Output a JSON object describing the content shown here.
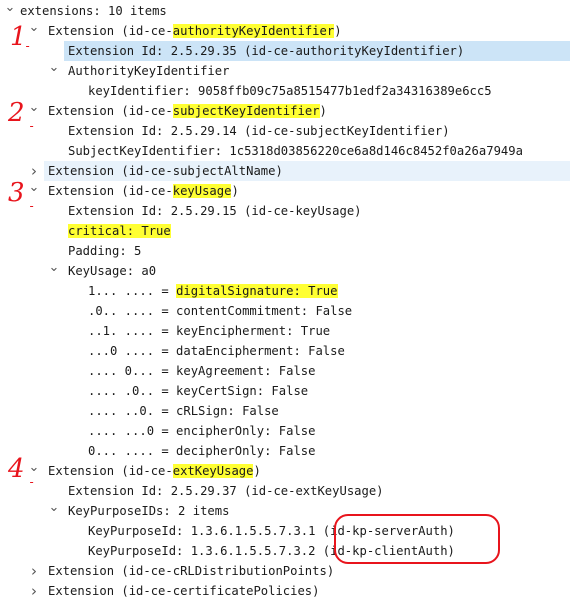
{
  "tree": {
    "rows": [
      {
        "text": "extensions: 10 items",
        "toggle": "v"
      },
      {
        "text": "Extension (id-ce-",
        "mark": "authorityKeyIdentifier",
        "after": ")",
        "toggle": "v"
      },
      {
        "text": "Extension Id: 2.5.29.35 (id-ce-authorityKeyIdentifier)",
        "toggle": ""
      },
      {
        "text": "AuthorityKeyIdentifier",
        "toggle": "v"
      },
      {
        "text": "keyIdentifier: 9058ffb09c75a8515477b1edf2a34316389e6cc5",
        "toggle": ""
      },
      {
        "text": "Extension (id-ce-",
        "mark": "subjectKeyIdentifier",
        "after": ")",
        "toggle": "v"
      },
      {
        "text": "Extension Id: 2.5.29.14 (id-ce-subjectKeyIdentifier)",
        "toggle": ""
      },
      {
        "text": "SubjectKeyIdentifier: 1c5318d03856220ce6a8d146c8452f0a26a7949a",
        "toggle": ""
      },
      {
        "text": "Extension (id-ce-subjectAltName)",
        "toggle": ">"
      },
      {
        "text": "Extension (id-ce-",
        "mark": "keyUsage",
        "after": ")",
        "toggle": "v"
      },
      {
        "text": "Extension Id: 2.5.29.15 (id-ce-keyUsage)",
        "toggle": ""
      },
      {
        "text": "",
        "mark": "critical: True",
        "after": "",
        "toggle": ""
      },
      {
        "text": "Padding: 5",
        "toggle": ""
      },
      {
        "text": "KeyUsage: a0",
        "toggle": "v"
      },
      {
        "text": "1... .... = ",
        "mark": "digitalSignature: True",
        "after": "",
        "toggle": ""
      },
      {
        "text": ".0.. .... = contentCommitment: False",
        "toggle": ""
      },
      {
        "text": "..1. .... = keyEncipherment: True",
        "toggle": ""
      },
      {
        "text": "...0 .... = dataEncipherment: False",
        "toggle": ""
      },
      {
        "text": ".... 0... = keyAgreement: False",
        "toggle": ""
      },
      {
        "text": ".... .0.. = keyCertSign: False",
        "toggle": ""
      },
      {
        "text": ".... ..0. = cRLSign: False",
        "toggle": ""
      },
      {
        "text": ".... ...0 = encipherOnly: False",
        "toggle": ""
      },
      {
        "text": "0... .... = decipherOnly: False",
        "toggle": ""
      },
      {
        "text": "Extension (id-ce-",
        "mark": "extKeyUsage",
        "after": ")",
        "toggle": "v"
      },
      {
        "text": "Extension Id: 2.5.29.37 (id-ce-extKeyUsage)",
        "toggle": ""
      },
      {
        "text": "KeyPurposeIDs: 2 items",
        "toggle": "v"
      },
      {
        "text": "KeyPurposeId: 1.3.6.1.5.5.7.3.1 (id-kp-serverAuth)",
        "toggle": ""
      },
      {
        "text": "KeyPurposeId: 1.3.6.1.5.5.7.3.2 (id-kp-clientAuth)",
        "toggle": ""
      },
      {
        "text": "Extension (id-ce-cRLDistributionPoints)",
        "toggle": ">"
      },
      {
        "text": "Extension (id-ce-certificatePolicies)",
        "toggle": ">"
      }
    ]
  },
  "annotations": {
    "numbers": [
      "1",
      "2",
      "3",
      "4"
    ],
    "highlight_color": "#ffff33",
    "ink_color": "#e8141c",
    "selection_color": "#cce4f7"
  }
}
